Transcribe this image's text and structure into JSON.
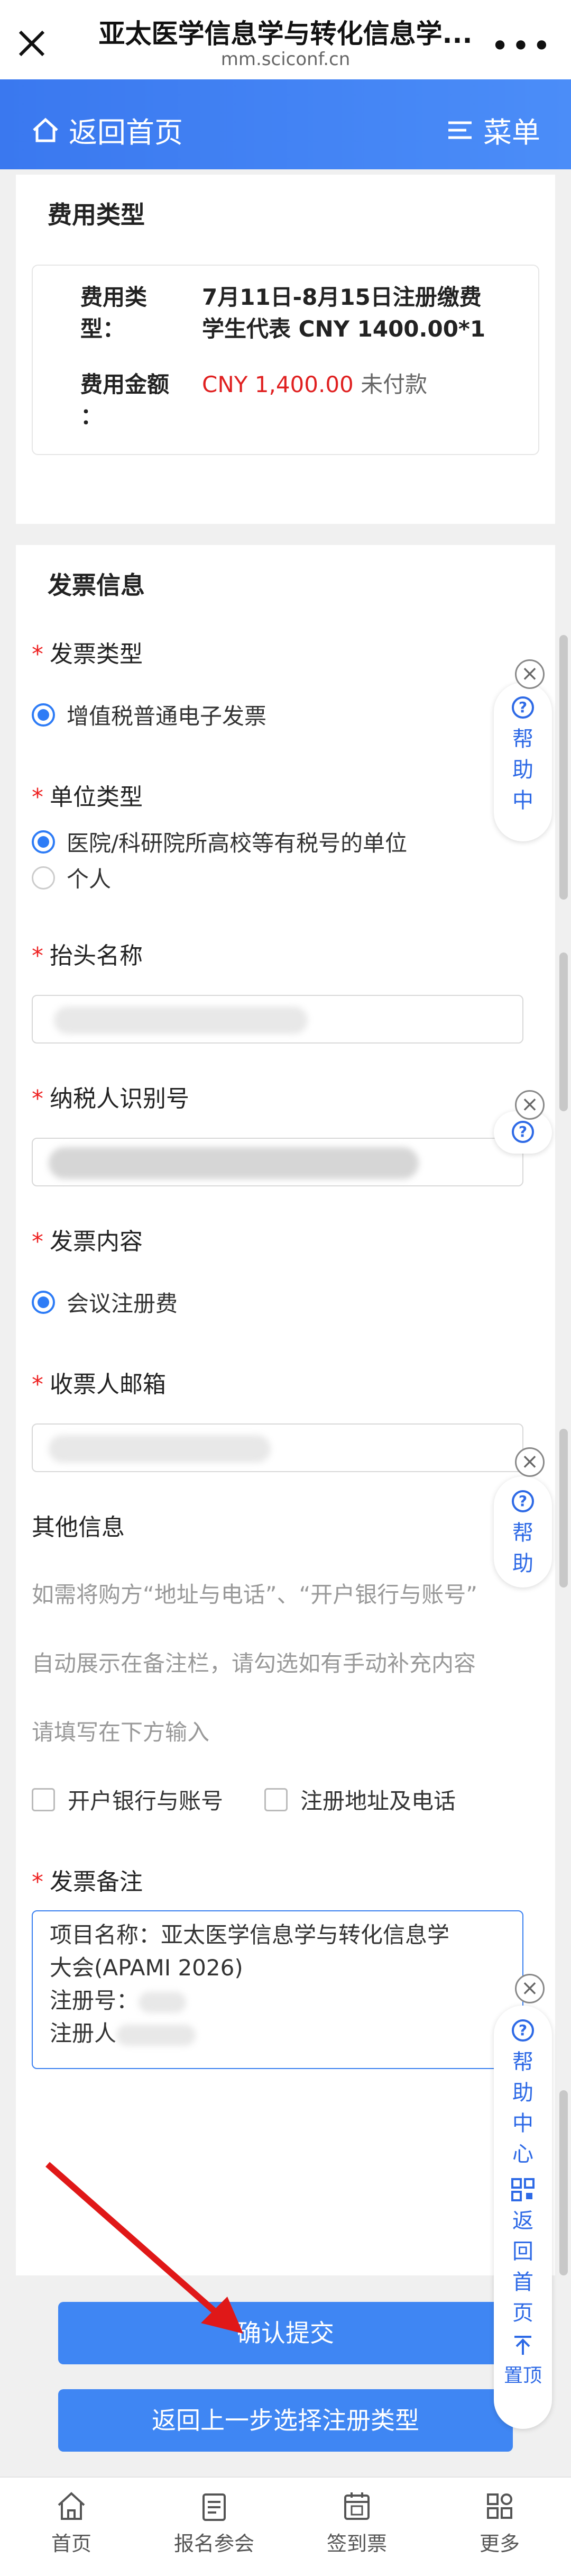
{
  "topbar": {
    "title": "亚太医学信息学与转化信息学...",
    "url": "mm.sciconf.cn"
  },
  "nav": {
    "back_label": "返回首页",
    "menu_label": "菜单"
  },
  "fee": {
    "section_title": "费用类型",
    "type_label_1": "费用类",
    "type_label_2": "型：",
    "type_value_1": "7月11日-8月15日注册缴费",
    "type_value_2": "学生代表 CNY 1400.00*1",
    "amount_label_1": "费用金额",
    "amount_label_2": "：",
    "amount_value": "CNY 1,400.00",
    "amount_status": "未付款"
  },
  "invoice": {
    "section_title": "发票信息",
    "invoice_type_label": "发票类型",
    "invoice_type_option": "增值税普通电子发票",
    "unit_type_label": "单位类型",
    "unit_type_options": [
      "医院/科研院所高校等有税号的单位",
      "个人"
    ],
    "title_label": "抬头名称",
    "taxpayer_label": "纳税人识别号",
    "content_label": "发票内容",
    "content_option": "会议注册费",
    "email_label": "收票人邮箱",
    "other_label": "其他信息",
    "other_hint_1": "如需将购方“地址与电话”、“开户银行与账号”",
    "other_hint_2": "自动展示在备注栏，请勾选如有手动补充内容",
    "other_hint_3": "请填写在下方输入",
    "checkbox_bank": "开户银行与账号",
    "checkbox_address": "注册地址及电话",
    "remark_label": "发票备注",
    "remark_line_1": "项目名称：亚太医学信息学与转化信息学",
    "remark_line_2": "大会(APAMI 2026)",
    "remark_line_3": "注册号：",
    "remark_line_4": "注册人"
  },
  "buttons": {
    "submit": "确认提交",
    "back_step": "返回上一步选择注册类型"
  },
  "help": {
    "help_chars": [
      "帮",
      "助",
      "中"
    ],
    "help_full": [
      "帮",
      "助",
      "中",
      "心"
    ],
    "back_top": [
      "返",
      "回",
      "首",
      "页"
    ],
    "top": "置顶"
  },
  "tabs": [
    {
      "label": "首页"
    },
    {
      "label": "报名参会"
    },
    {
      "label": "签到票"
    },
    {
      "label": "更多"
    }
  ],
  "colors": {
    "accent": "#3f86f3",
    "price": "#e02020",
    "required": "#e22222"
  }
}
